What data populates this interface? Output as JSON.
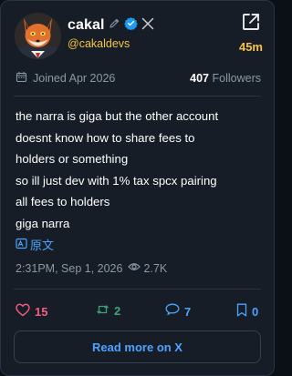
{
  "profile": {
    "display_name": "cakal",
    "handle": "@cakaldevs",
    "age": "45m",
    "joined": "Joined Apr 2026",
    "followers_count": "407",
    "followers_label": "Followers"
  },
  "tweet": {
    "lines": [
      "the narra is giga but the other account",
      "doesnt know how to share fees to",
      "holders or something",
      "so ill just dev with 1% tax spcx pairing",
      "all fees to holders",
      "giga narra"
    ],
    "translate_label": "原文",
    "timestamp": "2:31PM, Sep 1, 2026",
    "views": "2.7K"
  },
  "actions": {
    "likes": "15",
    "retweets": "2",
    "replies": "7",
    "bookmarks": "0"
  },
  "read_more_label": "Read more on X",
  "colors": {
    "accent_yellow": "#f5c542",
    "link_blue": "#4da3ff",
    "like_pink": "#f0607f",
    "retweet_green": "#3fa37a",
    "muted": "#8b98a5",
    "card_bg": "#161d26"
  }
}
